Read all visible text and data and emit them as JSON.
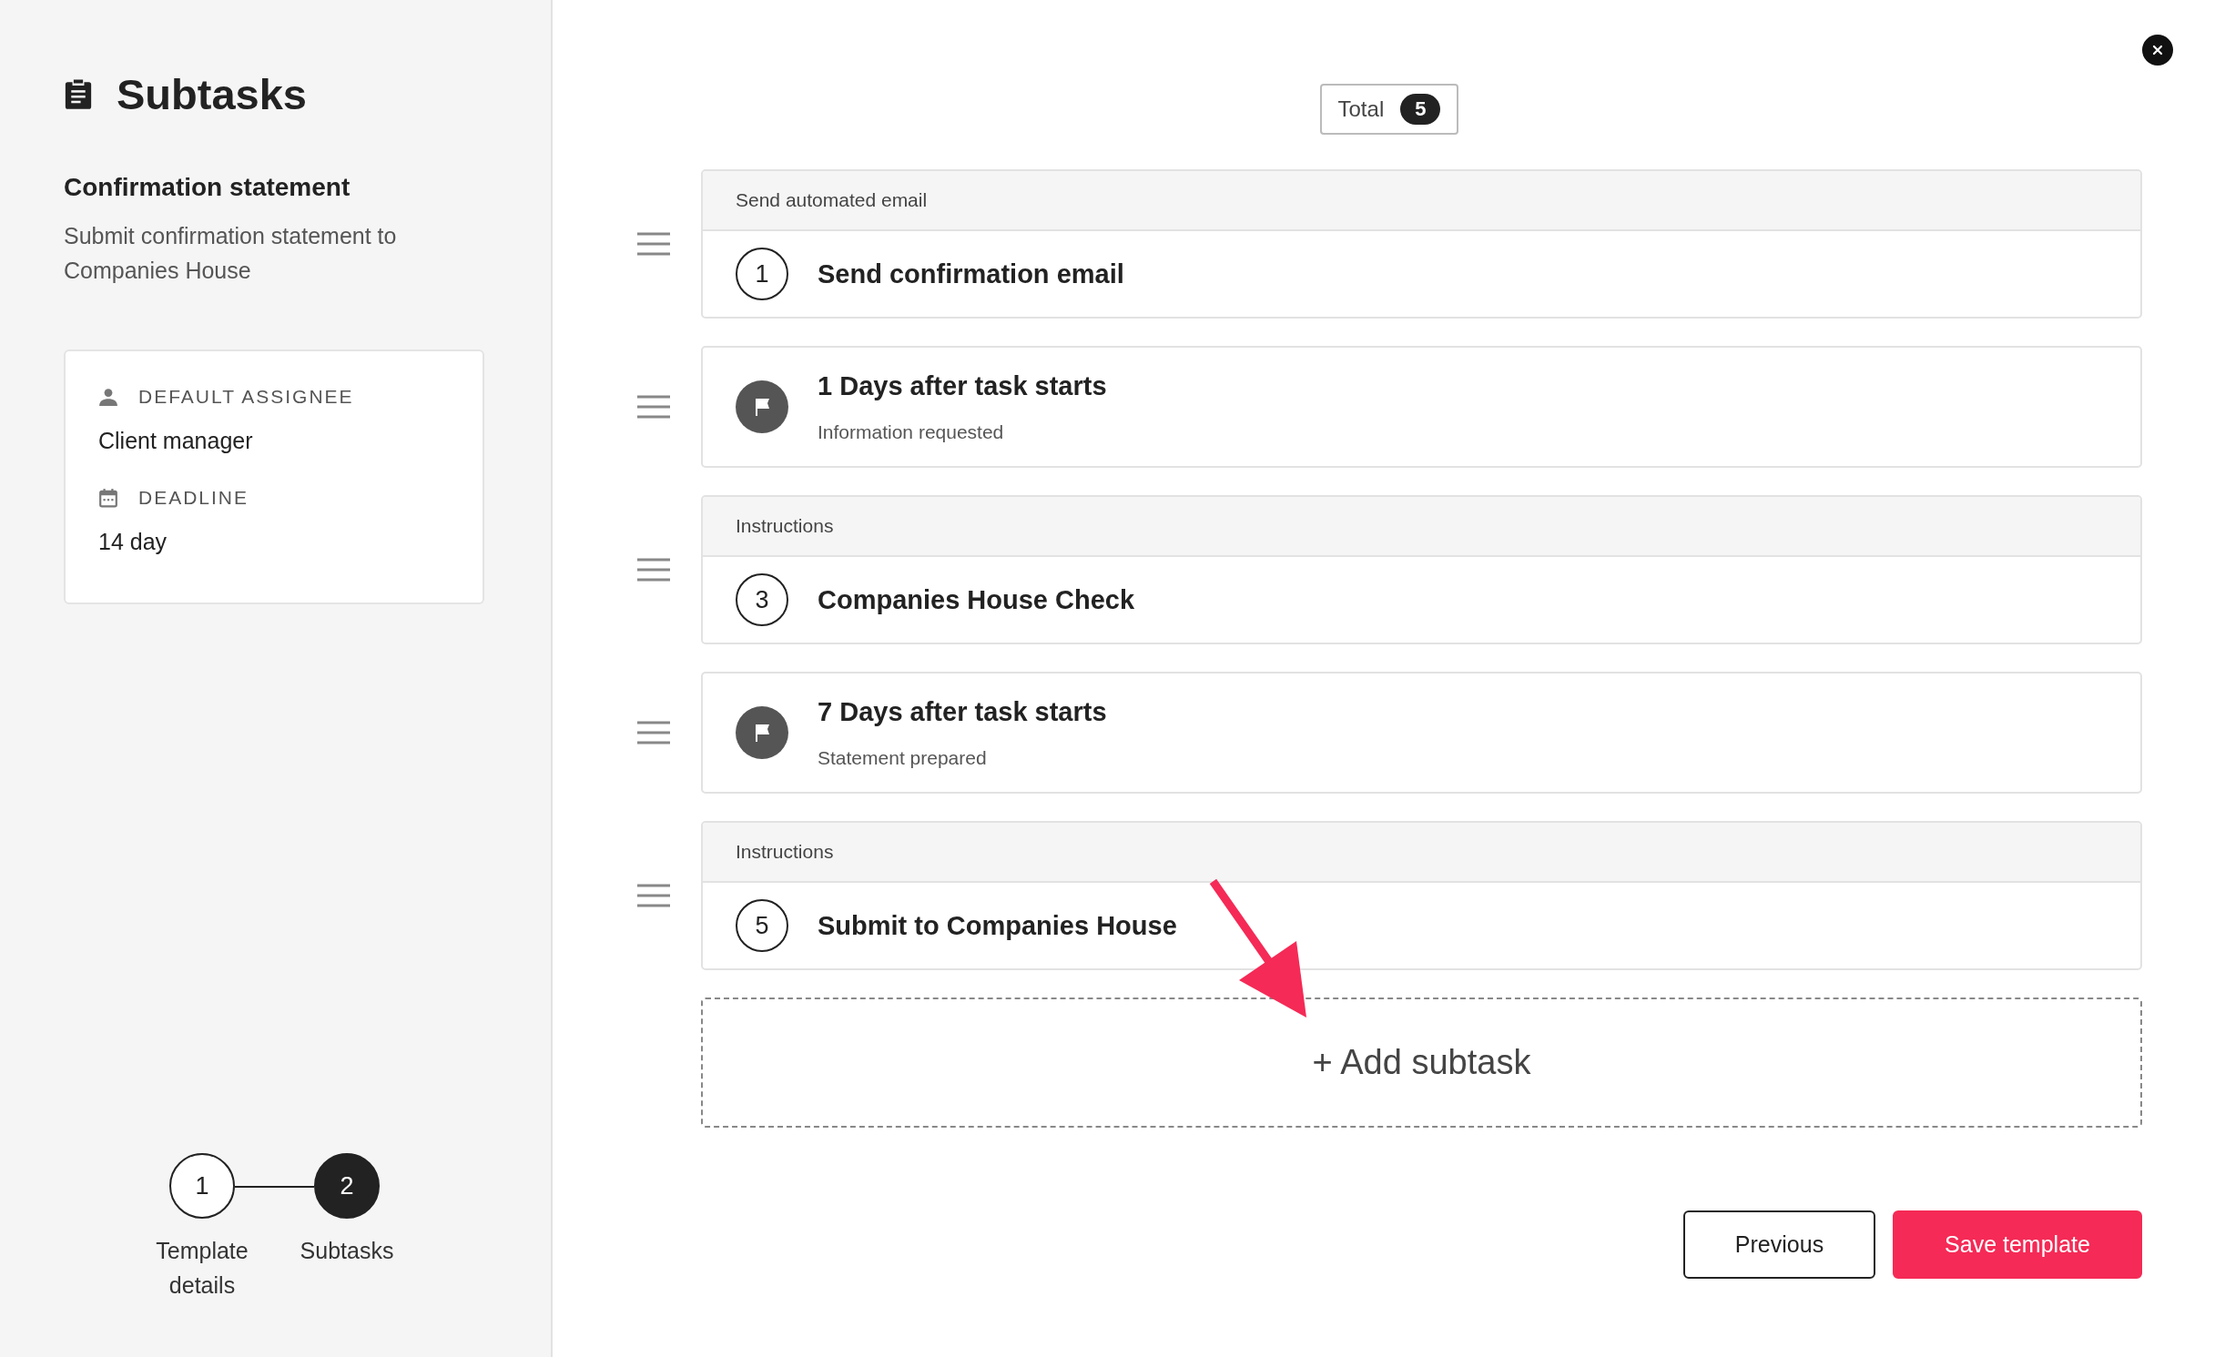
{
  "sidebar": {
    "title": "Subtasks",
    "template_name": "Confirmation statement",
    "description": "Submit confirmation statement to Companies House",
    "details": [
      {
        "kind": "assignee",
        "label": "DEFAULT ASSIGNEE",
        "value": "Client manager"
      },
      {
        "kind": "deadline",
        "label": "DEADLINE",
        "value": "14 day"
      }
    ],
    "steps": [
      {
        "number": "1",
        "label": "Template details",
        "selected": false
      },
      {
        "number": "2",
        "label": "Subtasks",
        "selected": true
      }
    ]
  },
  "total": {
    "label": "Total",
    "count": "5"
  },
  "subtasks": [
    {
      "kind": "step",
      "header": "Send automated email",
      "number": "1",
      "title": "Send confirmation email"
    },
    {
      "kind": "delay",
      "title": "1 Days after task starts",
      "note": "Information requested"
    },
    {
      "kind": "step",
      "header": "Instructions",
      "number": "3",
      "title": "Companies House Check"
    },
    {
      "kind": "delay",
      "title": "7 Days after task starts",
      "note": "Statement prepared"
    },
    {
      "kind": "step",
      "header": "Instructions",
      "number": "5",
      "title": "Submit to Companies House"
    }
  ],
  "add_button": "+ Add subtask",
  "buttons": [
    {
      "kind": "secondary",
      "label": "Previous"
    },
    {
      "kind": "primary",
      "label": "Save template"
    }
  ]
}
